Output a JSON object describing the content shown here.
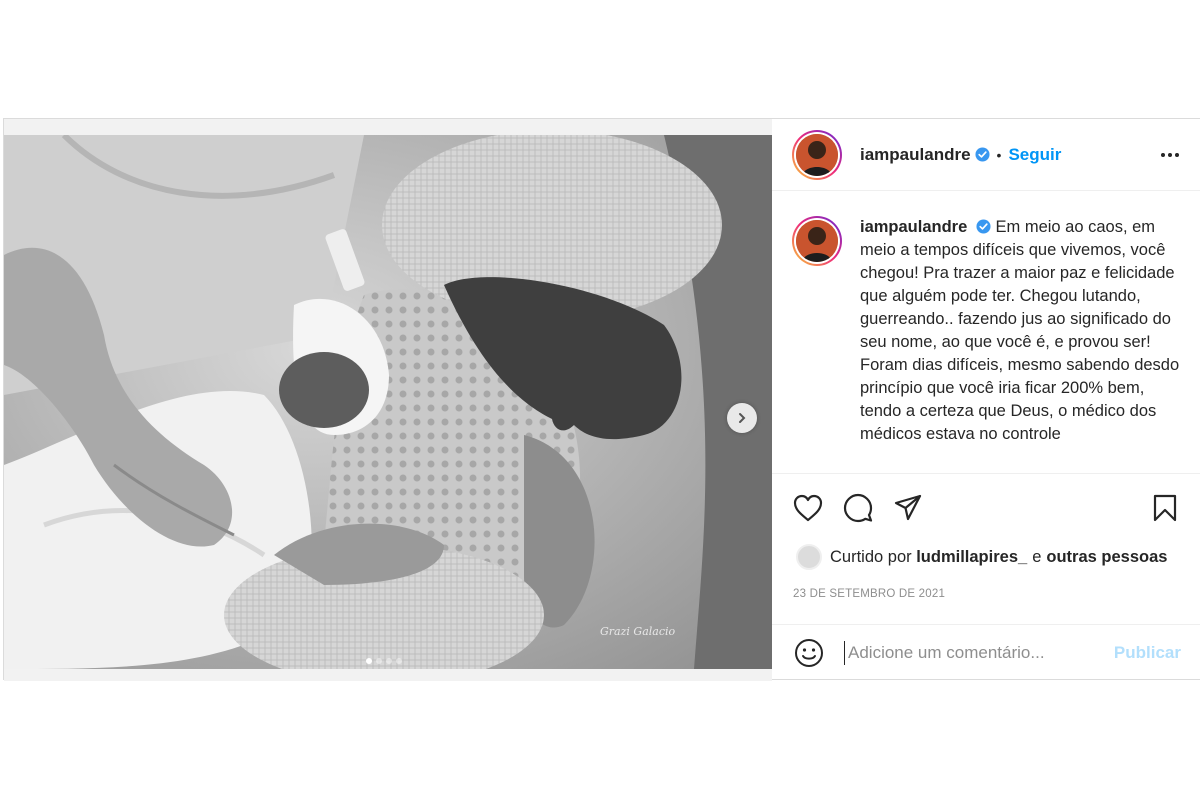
{
  "post": {
    "username": "iampaulandre",
    "follow_label": "Seguir",
    "separator": "•",
    "caption": "Em meio ao caos, em meio a tempos difíceis que vivemos, você chegou! Pra trazer a maior paz e felicidade que alguém pode ter. Chegou lutando, guerreando.. fazendo jus ao significado do seu nome, ao que você é, e provou ser! Foram dias difíceis, mesmo sabendo desdo princípio que você iria ficar 200% bem, tendo a certeza que Deus, o médico dos médicos estava no controle",
    "liked_prefix": "Curtido por",
    "liked_user": "ludmillapires_",
    "liked_joiner": "e",
    "liked_others": "outras pessoas",
    "date": "23 DE SETEMBRO DE 2021",
    "comment_placeholder": "Adicione um comentário...",
    "publish_label": "Publicar",
    "carousel_total": 4,
    "carousel_active": 1
  },
  "icons": {
    "verified": "verified-badge-icon",
    "like": "heart-icon",
    "comment": "comment-bubble-icon",
    "share": "paper-plane-icon",
    "save": "bookmark-icon",
    "emoji": "smiley-icon",
    "more": "more-options-icon",
    "next": "chevron-right-icon"
  },
  "colors": {
    "link": "#0095f6",
    "publish_disabled": "#b2dffc",
    "muted": "#8e8e8e",
    "text": "#262626",
    "verified": "#3897f0"
  }
}
